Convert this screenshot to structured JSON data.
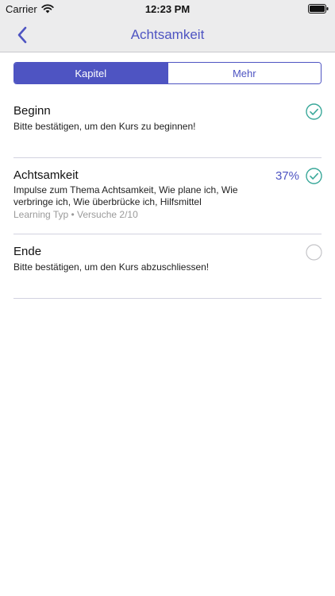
{
  "status_bar": {
    "carrier": "Carrier",
    "time": "12:23 PM",
    "wifi_icon": "wifi-icon",
    "battery_icon": "battery-full-icon"
  },
  "nav": {
    "title": "Achtsamkeit",
    "back_icon": "chevron-left-icon"
  },
  "tabs": [
    {
      "label": "Kapitel",
      "selected": true
    },
    {
      "label": "Mehr",
      "selected": false
    }
  ],
  "items": [
    {
      "title": "Beginn",
      "description": "Bitte bestätigen, um den Kurs zu beginnen!",
      "meta": "",
      "percent": "",
      "completed": true
    },
    {
      "title": "Achtsamkeit",
      "description": "Impulse zum Thema Achtsamkeit, Wie plane ich, Wie verbringe ich, Wie überbrücke ich, Hilfsmittel",
      "meta": "Learning Typ • Versuche 2/10",
      "percent": "37%",
      "completed": true
    },
    {
      "title": "Ende",
      "description": "Bitte bestätigen, um den Kurs abzuschliessen!",
      "meta": "",
      "percent": "",
      "completed": false
    }
  ],
  "colors": {
    "accent": "#4e54c2",
    "check": "#3aa89a",
    "bar_bg": "#ececed",
    "meta_text": "#9a9a9a"
  }
}
